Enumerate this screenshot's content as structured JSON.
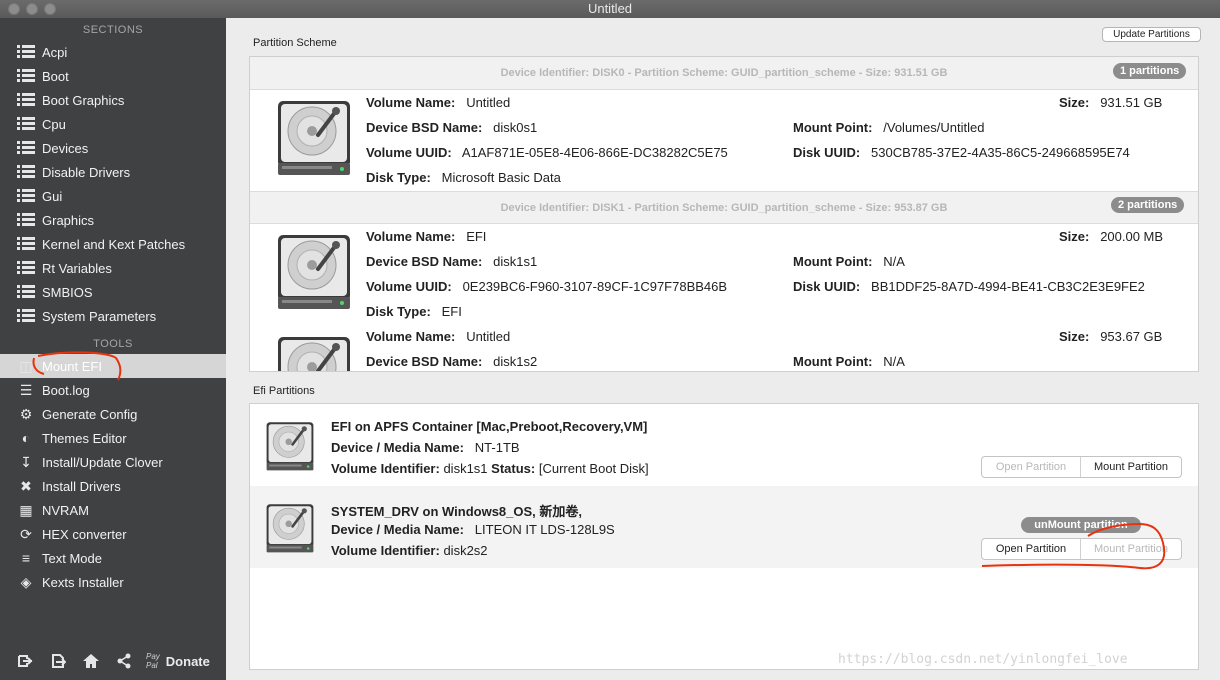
{
  "window": {
    "title": "Untitled"
  },
  "sidebar": {
    "sections_title": "SECTIONS",
    "sections": [
      {
        "label": "Acpi",
        "icon": "list-icon"
      },
      {
        "label": "Boot",
        "icon": "list-icon"
      },
      {
        "label": "Boot Graphics",
        "icon": "list-icon"
      },
      {
        "label": "Cpu",
        "icon": "list-icon"
      },
      {
        "label": "Devices",
        "icon": "list-icon"
      },
      {
        "label": "Disable Drivers",
        "icon": "list-icon"
      },
      {
        "label": "Gui",
        "icon": "list-icon"
      },
      {
        "label": "Graphics",
        "icon": "list-icon"
      },
      {
        "label": "Kernel and Kext Patches",
        "icon": "list-icon"
      },
      {
        "label": "Rt Variables",
        "icon": "list-icon"
      },
      {
        "label": "SMBIOS",
        "icon": "list-icon"
      },
      {
        "label": "System Parameters",
        "icon": "list-icon"
      }
    ],
    "tools_title": "TOOLS",
    "tools": [
      {
        "label": "Mount EFI",
        "icon": "disk-icon",
        "selected": true
      },
      {
        "label": "Boot.log",
        "icon": "log-search-icon"
      },
      {
        "label": "Generate Config",
        "icon": "gears-icon"
      },
      {
        "label": "Themes Editor",
        "icon": "palette-icon"
      },
      {
        "label": "Install/Update Clover",
        "icon": "download-icon"
      },
      {
        "label": "Install Drivers",
        "icon": "tools-icon"
      },
      {
        "label": "NVRAM",
        "icon": "chip-icon"
      },
      {
        "label": "HEX converter",
        "icon": "refresh-icon"
      },
      {
        "label": "Text Mode",
        "icon": "text-lines-icon"
      },
      {
        "label": "Kexts Installer",
        "icon": "puzzle-icon"
      }
    ],
    "bottom": {
      "paypal_top": "Pay",
      "paypal_bottom": "Pal",
      "donate": "Donate"
    }
  },
  "partition_scheme": {
    "label": "Partition Scheme",
    "update_button": "Update Partitions",
    "disks": [
      {
        "header": "Device Identifier: DISK0 - Partition Scheme: GUID_partition_scheme - Size: 931.51 GB",
        "badge": "1 partitions",
        "volumes": [
          {
            "volume_name": "Untitled",
            "size": "931.51 GB",
            "bsd_name": "disk0s1",
            "mount_point": "/Volumes/Untitled",
            "volume_uuid": "A1AF871E-05E8-4E06-866E-DC38282C5E75",
            "disk_uuid": "530CB785-37E2-4A35-86C5-249668595E74",
            "disk_type": "Microsoft Basic Data"
          }
        ]
      },
      {
        "header": "Device Identifier: DISK1 - Partition Scheme: GUID_partition_scheme - Size: 953.87 GB",
        "badge": "2 partitions",
        "volumes": [
          {
            "volume_name": "EFI",
            "size": "200.00 MB",
            "bsd_name": "disk1s1",
            "mount_point": "N/A",
            "volume_uuid": "0E239BC6-F960-3107-89CF-1C97F78BB46B",
            "disk_uuid": "BB1DDF25-8A7D-4994-BE41-CB3C2E3E9FE2",
            "disk_type": "EFI"
          },
          {
            "volume_name": "Untitled",
            "size": "953.67 GB",
            "bsd_name": "disk1s2",
            "mount_point": "N/A"
          }
        ]
      }
    ],
    "keys": {
      "volume_name": "Volume Name:",
      "size": "Size:",
      "bsd_name": "Device BSD Name:",
      "mount_point": "Mount Point:",
      "volume_uuid": "Volume UUID:",
      "disk_uuid": "Disk UUID:",
      "disk_type": "Disk Type:"
    }
  },
  "efi_partitions": {
    "label": "Efi Partitions",
    "keys": {
      "device_media": "Device / Media Name:",
      "volume_identifier": "Volume Identifier:",
      "status": "Status:"
    },
    "items": [
      {
        "title": "EFI on APFS Container [Mac,Preboot,Recovery,VM]",
        "device_media": "NT-1TB",
        "volume_identifier": "disk1s1",
        "status": "[Current Boot Disk]",
        "open_label": "Open Partition",
        "mount_label": "Mount Partition"
      },
      {
        "title": "SYSTEM_DRV on Windows8_OS, 新加卷,",
        "device_media": "LITEON IT LDS-128L9S",
        "volume_identifier": "disk2s2",
        "badge": "unMount partition",
        "open_label": "Open Partition",
        "mount_label": "Mount Partition"
      }
    ]
  },
  "watermark": "https://blog.csdn.net/yinlongfei_love",
  "colors": {
    "sidebar_bg": "#3f4142",
    "main_bg": "#ececec",
    "pill_gray": "#8c8c8c",
    "annotation_red": "#e8320e"
  }
}
